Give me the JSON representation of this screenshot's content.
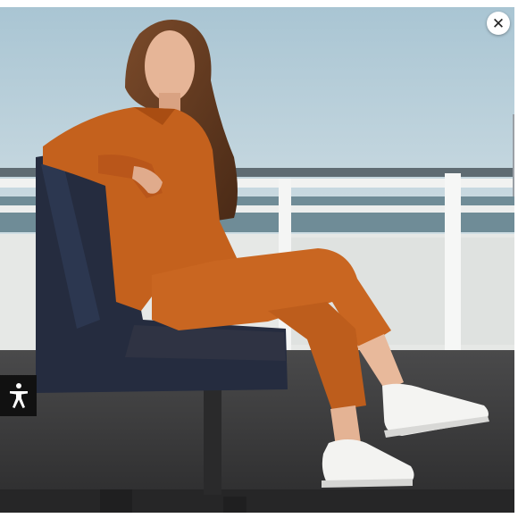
{
  "photo": {
    "alt": "",
    "colors": {
      "sky_top": "#b5cedb",
      "sky_bottom": "#d3e1e7",
      "outfit": "#c4611d",
      "bench": "#252c3f",
      "railing": "#e9ebea",
      "deck": "#3b3b3c"
    }
  },
  "controls": {
    "close_icon": "close-icon",
    "close_glyph": "✕",
    "accessibility_icon": "accessibility-icon"
  }
}
